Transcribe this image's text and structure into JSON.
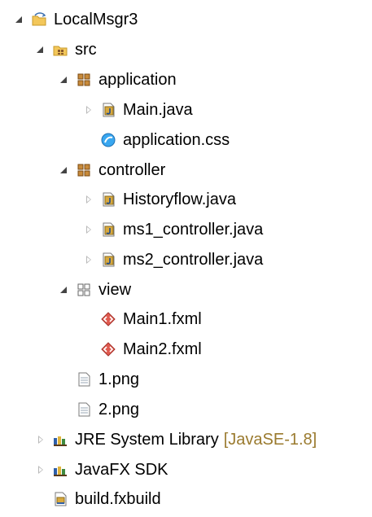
{
  "tree": [
    {
      "label": "LocalMsgr3",
      "decoration": "",
      "icon": "project-folder-icon",
      "state": "expanded"
    },
    {
      "label": "src",
      "decoration": "",
      "icon": "source-folder-icon",
      "state": "expanded"
    },
    {
      "label": "application",
      "decoration": "",
      "icon": "package-icon",
      "state": "expanded"
    },
    {
      "label": "Main.java",
      "decoration": "",
      "icon": "java-file-icon",
      "state": "collapsed"
    },
    {
      "label": "application.css",
      "decoration": "",
      "icon": "css-file-icon",
      "state": "none"
    },
    {
      "label": "controller",
      "decoration": "",
      "icon": "package-icon",
      "state": "expanded"
    },
    {
      "label": "Historyflow.java",
      "decoration": "",
      "icon": "java-file-icon",
      "state": "collapsed"
    },
    {
      "label": "ms1_controller.java",
      "decoration": "",
      "icon": "java-file-icon",
      "state": "collapsed"
    },
    {
      "label": "ms2_controller.java",
      "decoration": "",
      "icon": "java-file-icon",
      "state": "collapsed"
    },
    {
      "label": "view",
      "decoration": "",
      "icon": "empty-package-icon",
      "state": "expanded"
    },
    {
      "label": "Main1.fxml",
      "decoration": "",
      "icon": "fxml-file-icon",
      "state": "none"
    },
    {
      "label": "Main2.fxml",
      "decoration": "",
      "icon": "fxml-file-icon",
      "state": "none"
    },
    {
      "label": "1.png",
      "decoration": "",
      "icon": "text-file-icon",
      "state": "none"
    },
    {
      "label": "2.png",
      "decoration": "",
      "icon": "text-file-icon",
      "state": "none"
    },
    {
      "label": "JRE System Library",
      "decoration": "[JavaSE-1.8]",
      "icon": "library-icon",
      "state": "collapsed"
    },
    {
      "label": "JavaFX SDK",
      "decoration": "",
      "icon": "library-icon",
      "state": "collapsed"
    },
    {
      "label": "build.fxbuild",
      "decoration": "",
      "icon": "fxbuild-file-icon",
      "state": "none"
    }
  ]
}
